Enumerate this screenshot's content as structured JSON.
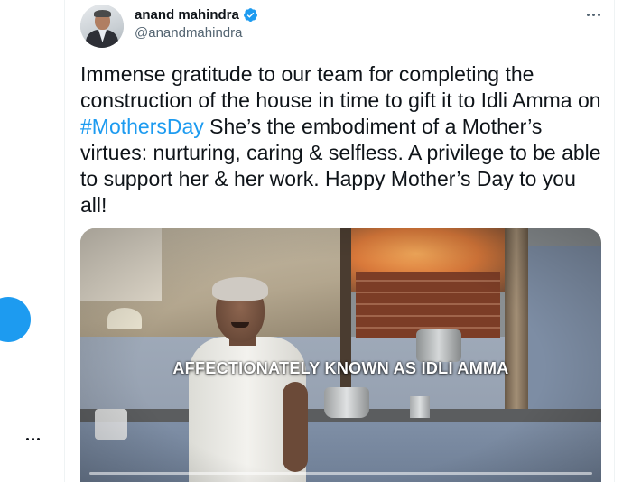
{
  "tweet": {
    "author": {
      "display_name": "anand mahindra",
      "handle": "@anandmahindra",
      "verified": true
    },
    "text": {
      "part1": "Immense gratitude to our team for completing the construction of the house in time to gift it to Idli Amma on ",
      "hashtag": "#MothersDay",
      "part2": " She’s the embodiment of a Mother’s virtues: nurturing, caring & selfless. A privilege to be able to support her & her work. Happy Mother’s Day to you all!"
    },
    "media": {
      "type": "video",
      "caption": "AFFECTIONATELY KNOWN AS IDLI AMMA",
      "progress": 0.0
    }
  },
  "colors": {
    "accent": "#1d9bf0",
    "text_primary": "#0f1419",
    "text_secondary": "#536471"
  },
  "icons": {
    "verified": "verified-badge-icon",
    "more": "more-horizontal-icon",
    "rail_more": "more-horizontal-icon",
    "rail_fab": "compose-fab"
  }
}
